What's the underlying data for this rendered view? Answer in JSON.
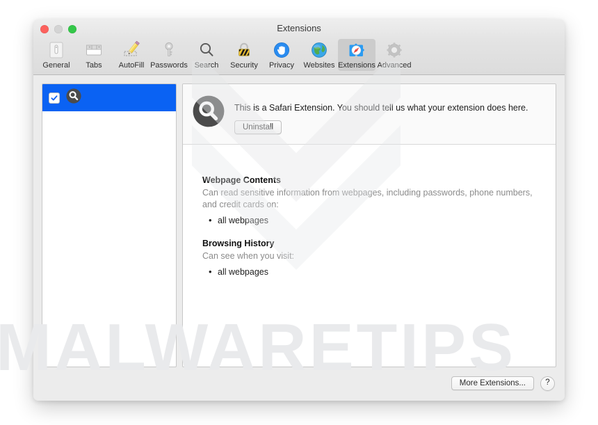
{
  "window": {
    "title": "Extensions",
    "traffic_lights": [
      {
        "name": "close-button",
        "color": "#fc615d"
      },
      {
        "name": "minimize-button",
        "color": "#d4d4d4"
      },
      {
        "name": "zoom-button",
        "color": "#34c749"
      }
    ]
  },
  "toolbar": {
    "items": [
      {
        "label": "General",
        "icon": "general-icon",
        "selected": false
      },
      {
        "label": "Tabs",
        "icon": "tabs-icon",
        "selected": false
      },
      {
        "label": "AutoFill",
        "icon": "autofill-icon",
        "selected": false
      },
      {
        "label": "Passwords",
        "icon": "passwords-icon",
        "selected": false
      },
      {
        "label": "Search",
        "icon": "search-icon",
        "selected": false
      },
      {
        "label": "Security",
        "icon": "security-icon",
        "selected": false
      },
      {
        "label": "Privacy",
        "icon": "privacy-icon",
        "selected": false
      },
      {
        "label": "Websites",
        "icon": "websites-icon",
        "selected": false
      },
      {
        "label": "Extensions",
        "icon": "extensions-icon",
        "selected": true
      },
      {
        "label": "Advanced",
        "icon": "advanced-icon",
        "selected": false
      }
    ]
  },
  "sidebar": {
    "extensions": [
      {
        "name": "magnifier-extension",
        "icon": "magnifier-icon",
        "enabled": true,
        "selected": true,
        "label": ""
      }
    ]
  },
  "detail": {
    "icon": "magnifier-icon",
    "description": "This is a Safari Extension. You should tell us what your extension does here.",
    "uninstall_label": "Uninstall",
    "permissions": [
      {
        "title": "Webpage Contents",
        "body": "Can read sensitive information from webpages, including passwords, phone numbers, and credit cards on:",
        "items": [
          "all webpages"
        ]
      },
      {
        "title": "Browsing History",
        "body": "Can see when you visit:",
        "items": [
          "all webpages"
        ]
      }
    ]
  },
  "footer": {
    "more_extensions_label": "More Extensions...",
    "help_label": "?"
  },
  "watermark": {
    "text": "MALWARETIPS",
    "color": "#e9eaec"
  },
  "colors": {
    "selection_blue": "#0a62f3",
    "window_chrome": "#ececec",
    "toolbar_selected": "#cccccc"
  }
}
